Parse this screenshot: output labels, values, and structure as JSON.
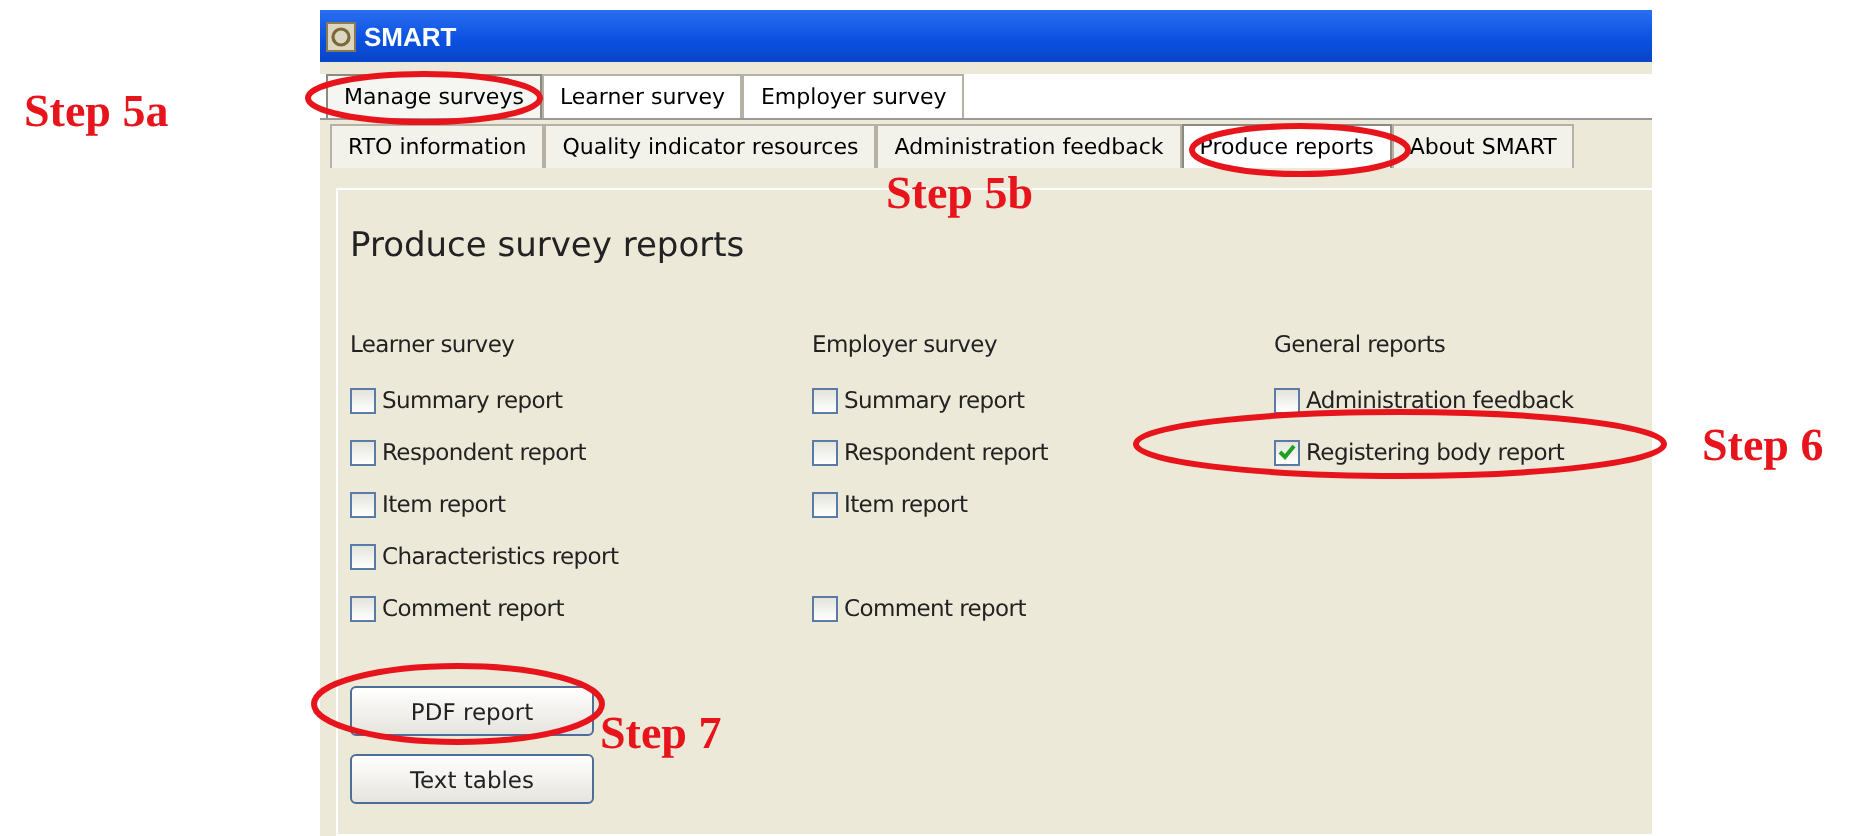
{
  "window": {
    "title": "SMART"
  },
  "main_tabs": [
    {
      "label": "Manage surveys",
      "selected": true
    },
    {
      "label": "Learner survey",
      "selected": false
    },
    {
      "label": "Employer survey",
      "selected": false
    }
  ],
  "sub_tabs": [
    {
      "label": "RTO information",
      "selected": false
    },
    {
      "label": "Quality indicator resources",
      "selected": false
    },
    {
      "label": "Administration feedback",
      "selected": false
    },
    {
      "label": "Produce reports",
      "selected": true
    },
    {
      "label": "About SMART",
      "selected": false
    }
  ],
  "heading": "Produce survey reports",
  "columns": [
    {
      "title": "Learner survey",
      "items": [
        {
          "kind": "checkbox",
          "label": "Summary report",
          "checked": false
        },
        {
          "kind": "checkbox",
          "label": "Respondent report",
          "checked": false
        },
        {
          "kind": "checkbox",
          "label": "Item report",
          "checked": false
        },
        {
          "kind": "checkbox",
          "label": "Characteristics report",
          "checked": false
        },
        {
          "kind": "checkbox",
          "label": "Comment report",
          "checked": false
        }
      ]
    },
    {
      "title": "Employer survey",
      "items": [
        {
          "kind": "checkbox",
          "label": "Summary report",
          "checked": false
        },
        {
          "kind": "checkbox",
          "label": "Respondent report",
          "checked": false
        },
        {
          "kind": "checkbox",
          "label": "Item report",
          "checked": false
        },
        {
          "kind": "blank"
        },
        {
          "kind": "checkbox",
          "label": "Comment report",
          "checked": false
        }
      ]
    },
    {
      "title": "General reports",
      "items": [
        {
          "kind": "checkbox",
          "label": "Administration feedback",
          "checked": false
        },
        {
          "kind": "checkbox",
          "label": "Registering body report",
          "checked": true
        }
      ]
    }
  ],
  "buttons": [
    "PDF report",
    "Text tables"
  ],
  "annotations": [
    {
      "label": "Step 5a"
    },
    {
      "label": "Step 5b"
    },
    {
      "label": "Step 6"
    },
    {
      "label": "Step 7"
    }
  ]
}
